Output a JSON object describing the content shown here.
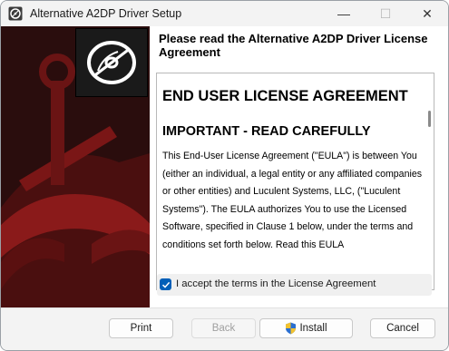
{
  "window": {
    "title": "Alternative A2DP Driver Setup",
    "controls": {
      "minimize": "—",
      "maximize": "☐",
      "close": "✕"
    }
  },
  "panel": {
    "heading": "Please read the Alternative A2DP Driver License Agreement"
  },
  "eula": {
    "title": "END USER LICENSE AGREEMENT",
    "subtitle": "IMPORTANT - READ CAREFULLY",
    "body": "This End-User License Agreement (\"EULA\") is between You (either an individual, a legal entity or any affiliated companies or other entities) and Luculent Systems, LLC, (\"Luculent Systems\"). The EULA authorizes You to use the Licensed Software, specified in Clause 1 below, under the terms and conditions set forth below. Read this EULA"
  },
  "accept": {
    "label": "I accept the terms in the License Agreement",
    "checked": true
  },
  "buttons": {
    "print": "Print",
    "back": "Back",
    "install": "Install",
    "cancel": "Cancel"
  },
  "icons": {
    "app": "installer-disc-icon",
    "logo": "disc-logo-icon",
    "install": "uac-shield-icon"
  },
  "colors": {
    "banner_dark": "#2a0d0d",
    "banner_red": "#7a1616",
    "checkbox": "#005fb8"
  }
}
